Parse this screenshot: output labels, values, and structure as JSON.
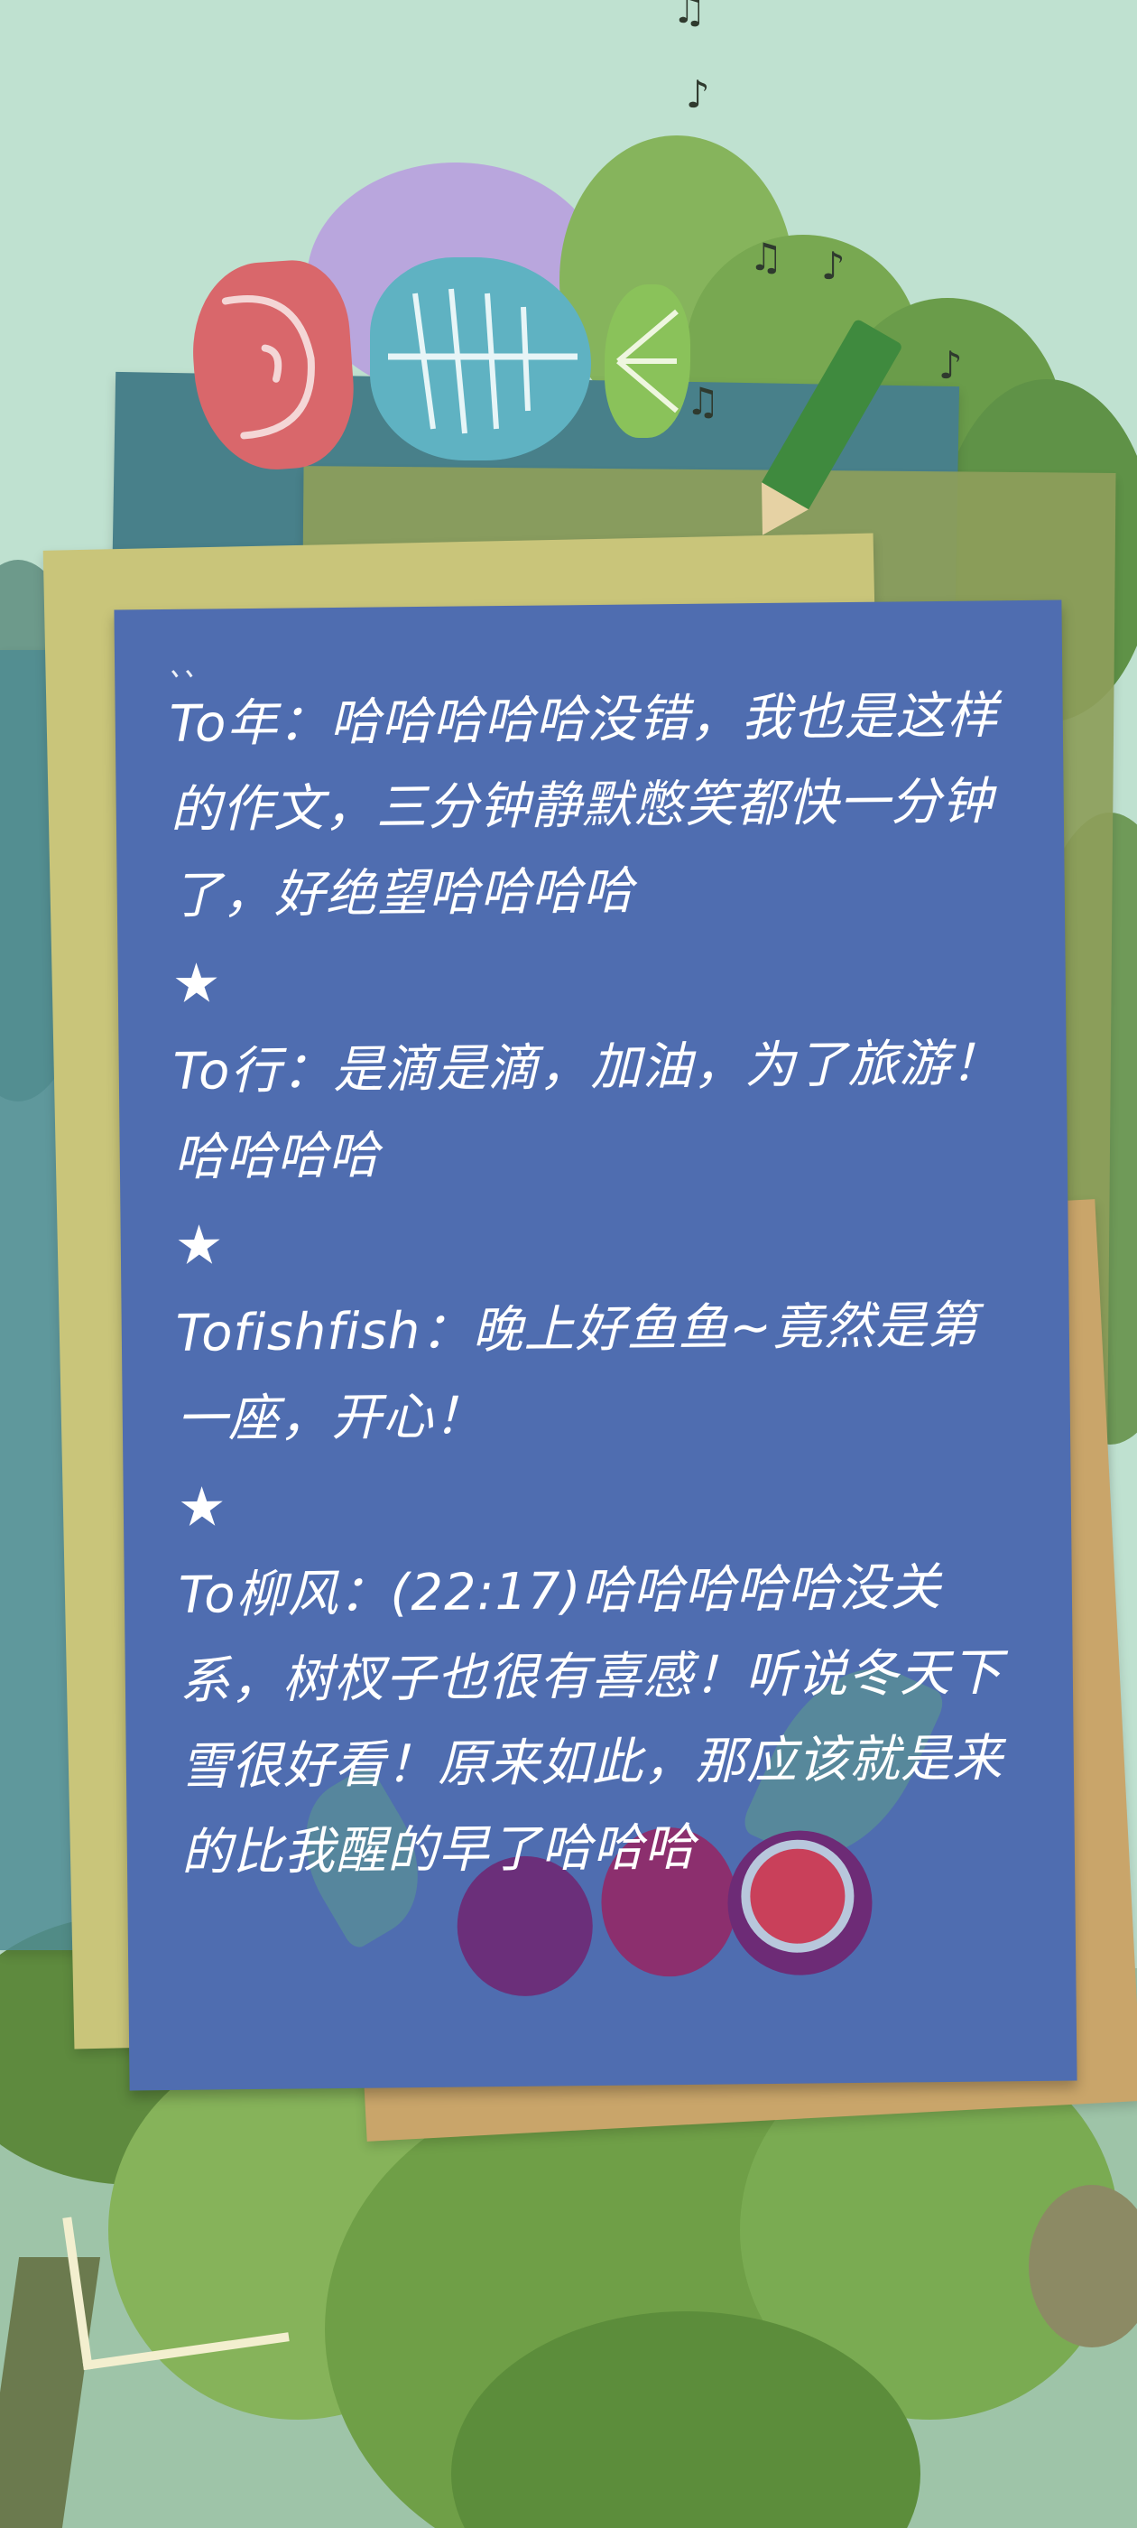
{
  "note": {
    "ticks": "、、",
    "star": "★",
    "messages": [
      {
        "text": "To年：哈哈哈哈哈没错，我也是这样的作文，三分钟静默憋笑都快一分钟了，好绝望哈哈哈哈"
      },
      {
        "text": "To行：是滴是滴，加油，为了旅游！哈哈哈哈"
      },
      {
        "text": "Tofishfish：晚上好鱼鱼~竟然是第一座，开心！"
      },
      {
        "text": "To柳风：(22:17)哈哈哈哈哈没关系，树杈子也很有喜感！听说冬天下雪很好看！原来如此，那应该就是来的比我醒的早了哈哈哈"
      }
    ]
  },
  "decor": {
    "music_notes": [
      "♫",
      "♪",
      "♫",
      "♪",
      "♪",
      "♫"
    ]
  },
  "colors": {
    "background": "#bfe1d0",
    "note_blue": "#4f6db0",
    "paper_yellow": "#c9c57a",
    "paper_teal": "#4f8c93",
    "paper_tan": "#c9a56a",
    "tree_green": "#6e9f4a"
  }
}
